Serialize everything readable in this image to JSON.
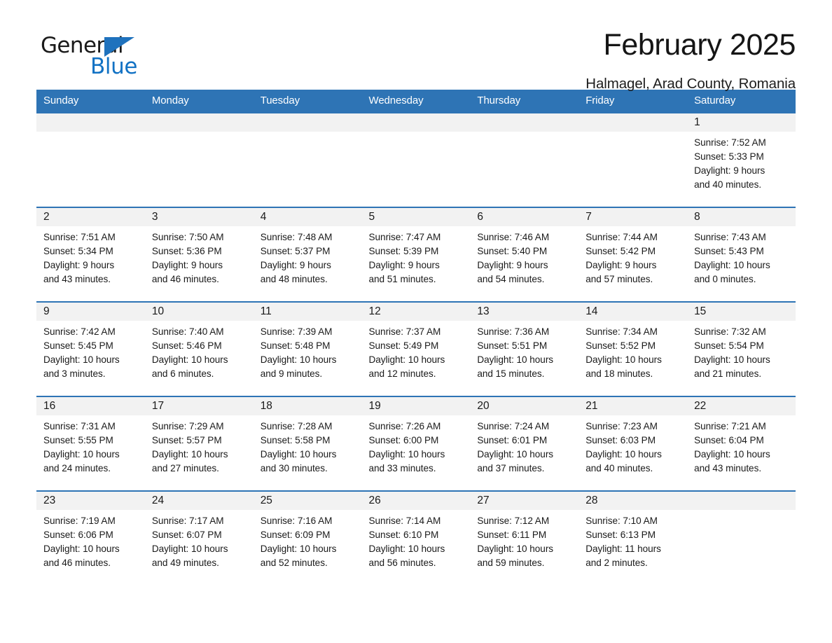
{
  "logo": {
    "word1": "General",
    "word2": "Blue",
    "triangle_color": "#1f72bd",
    "blue_color": "#1272c4"
  },
  "header": {
    "month_title": "February 2025",
    "location": "Halmagel, Arad County, Romania"
  },
  "theme": {
    "header_blue": "#2e74b5",
    "daynum_band": "#f2f2f2"
  },
  "calendar": {
    "weekday_headers": [
      "Sunday",
      "Monday",
      "Tuesday",
      "Wednesday",
      "Thursday",
      "Friday",
      "Saturday"
    ],
    "weeks": [
      [
        {
          "day": "",
          "blank": true
        },
        {
          "day": "",
          "blank": true
        },
        {
          "day": "",
          "blank": true
        },
        {
          "day": "",
          "blank": true
        },
        {
          "day": "",
          "blank": true
        },
        {
          "day": "",
          "blank": true
        },
        {
          "day": "1",
          "sunrise": "Sunrise: 7:52 AM",
          "sunset": "Sunset: 5:33 PM",
          "daylight_l1": "Daylight: 9 hours",
          "daylight_l2": "and 40 minutes."
        }
      ],
      [
        {
          "day": "2",
          "sunrise": "Sunrise: 7:51 AM",
          "sunset": "Sunset: 5:34 PM",
          "daylight_l1": "Daylight: 9 hours",
          "daylight_l2": "and 43 minutes."
        },
        {
          "day": "3",
          "sunrise": "Sunrise: 7:50 AM",
          "sunset": "Sunset: 5:36 PM",
          "daylight_l1": "Daylight: 9 hours",
          "daylight_l2": "and 46 minutes."
        },
        {
          "day": "4",
          "sunrise": "Sunrise: 7:48 AM",
          "sunset": "Sunset: 5:37 PM",
          "daylight_l1": "Daylight: 9 hours",
          "daylight_l2": "and 48 minutes."
        },
        {
          "day": "5",
          "sunrise": "Sunrise: 7:47 AM",
          "sunset": "Sunset: 5:39 PM",
          "daylight_l1": "Daylight: 9 hours",
          "daylight_l2": "and 51 minutes."
        },
        {
          "day": "6",
          "sunrise": "Sunrise: 7:46 AM",
          "sunset": "Sunset: 5:40 PM",
          "daylight_l1": "Daylight: 9 hours",
          "daylight_l2": "and 54 minutes."
        },
        {
          "day": "7",
          "sunrise": "Sunrise: 7:44 AM",
          "sunset": "Sunset: 5:42 PM",
          "daylight_l1": "Daylight: 9 hours",
          "daylight_l2": "and 57 minutes."
        },
        {
          "day": "8",
          "sunrise": "Sunrise: 7:43 AM",
          "sunset": "Sunset: 5:43 PM",
          "daylight_l1": "Daylight: 10 hours",
          "daylight_l2": "and 0 minutes."
        }
      ],
      [
        {
          "day": "9",
          "sunrise": "Sunrise: 7:42 AM",
          "sunset": "Sunset: 5:45 PM",
          "daylight_l1": "Daylight: 10 hours",
          "daylight_l2": "and 3 minutes."
        },
        {
          "day": "10",
          "sunrise": "Sunrise: 7:40 AM",
          "sunset": "Sunset: 5:46 PM",
          "daylight_l1": "Daylight: 10 hours",
          "daylight_l2": "and 6 minutes."
        },
        {
          "day": "11",
          "sunrise": "Sunrise: 7:39 AM",
          "sunset": "Sunset: 5:48 PM",
          "daylight_l1": "Daylight: 10 hours",
          "daylight_l2": "and 9 minutes."
        },
        {
          "day": "12",
          "sunrise": "Sunrise: 7:37 AM",
          "sunset": "Sunset: 5:49 PM",
          "daylight_l1": "Daylight: 10 hours",
          "daylight_l2": "and 12 minutes."
        },
        {
          "day": "13",
          "sunrise": "Sunrise: 7:36 AM",
          "sunset": "Sunset: 5:51 PM",
          "daylight_l1": "Daylight: 10 hours",
          "daylight_l2": "and 15 minutes."
        },
        {
          "day": "14",
          "sunrise": "Sunrise: 7:34 AM",
          "sunset": "Sunset: 5:52 PM",
          "daylight_l1": "Daylight: 10 hours",
          "daylight_l2": "and 18 minutes."
        },
        {
          "day": "15",
          "sunrise": "Sunrise: 7:32 AM",
          "sunset": "Sunset: 5:54 PM",
          "daylight_l1": "Daylight: 10 hours",
          "daylight_l2": "and 21 minutes."
        }
      ],
      [
        {
          "day": "16",
          "sunrise": "Sunrise: 7:31 AM",
          "sunset": "Sunset: 5:55 PM",
          "daylight_l1": "Daylight: 10 hours",
          "daylight_l2": "and 24 minutes."
        },
        {
          "day": "17",
          "sunrise": "Sunrise: 7:29 AM",
          "sunset": "Sunset: 5:57 PM",
          "daylight_l1": "Daylight: 10 hours",
          "daylight_l2": "and 27 minutes."
        },
        {
          "day": "18",
          "sunrise": "Sunrise: 7:28 AM",
          "sunset": "Sunset: 5:58 PM",
          "daylight_l1": "Daylight: 10 hours",
          "daylight_l2": "and 30 minutes."
        },
        {
          "day": "19",
          "sunrise": "Sunrise: 7:26 AM",
          "sunset": "Sunset: 6:00 PM",
          "daylight_l1": "Daylight: 10 hours",
          "daylight_l2": "and 33 minutes."
        },
        {
          "day": "20",
          "sunrise": "Sunrise: 7:24 AM",
          "sunset": "Sunset: 6:01 PM",
          "daylight_l1": "Daylight: 10 hours",
          "daylight_l2": "and 37 minutes."
        },
        {
          "day": "21",
          "sunrise": "Sunrise: 7:23 AM",
          "sunset": "Sunset: 6:03 PM",
          "daylight_l1": "Daylight: 10 hours",
          "daylight_l2": "and 40 minutes."
        },
        {
          "day": "22",
          "sunrise": "Sunrise: 7:21 AM",
          "sunset": "Sunset: 6:04 PM",
          "daylight_l1": "Daylight: 10 hours",
          "daylight_l2": "and 43 minutes."
        }
      ],
      [
        {
          "day": "23",
          "sunrise": "Sunrise: 7:19 AM",
          "sunset": "Sunset: 6:06 PM",
          "daylight_l1": "Daylight: 10 hours",
          "daylight_l2": "and 46 minutes."
        },
        {
          "day": "24",
          "sunrise": "Sunrise: 7:17 AM",
          "sunset": "Sunset: 6:07 PM",
          "daylight_l1": "Daylight: 10 hours",
          "daylight_l2": "and 49 minutes."
        },
        {
          "day": "25",
          "sunrise": "Sunrise: 7:16 AM",
          "sunset": "Sunset: 6:09 PM",
          "daylight_l1": "Daylight: 10 hours",
          "daylight_l2": "and 52 minutes."
        },
        {
          "day": "26",
          "sunrise": "Sunrise: 7:14 AM",
          "sunset": "Sunset: 6:10 PM",
          "daylight_l1": "Daylight: 10 hours",
          "daylight_l2": "and 56 minutes."
        },
        {
          "day": "27",
          "sunrise": "Sunrise: 7:12 AM",
          "sunset": "Sunset: 6:11 PM",
          "daylight_l1": "Daylight: 10 hours",
          "daylight_l2": "and 59 minutes."
        },
        {
          "day": "28",
          "sunrise": "Sunrise: 7:10 AM",
          "sunset": "Sunset: 6:13 PM",
          "daylight_l1": "Daylight: 11 hours",
          "daylight_l2": "and 2 minutes."
        },
        {
          "day": "",
          "blank": true
        }
      ]
    ]
  }
}
